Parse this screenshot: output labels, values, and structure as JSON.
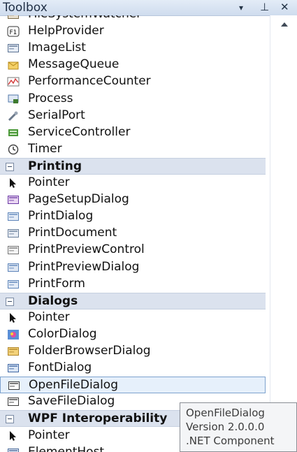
{
  "toolbox": {
    "title": "Toolbox",
    "dropdown_glyph": "▾",
    "pin_glyph": "⊥",
    "close_glyph": "✕"
  },
  "items": [
    {
      "label": "FileSystemWatcher",
      "icon": "filesystemwatcher-icon",
      "type": "item"
    },
    {
      "label": "HelpProvider",
      "icon": "f1-help-icon",
      "type": "item"
    },
    {
      "label": "ImageList",
      "icon": "imagelist-icon",
      "type": "item"
    },
    {
      "label": "MessageQueue",
      "icon": "messagequeue-icon",
      "type": "item"
    },
    {
      "label": "PerformanceCounter",
      "icon": "performancecounter-icon",
      "type": "item"
    },
    {
      "label": "Process",
      "icon": "process-icon",
      "type": "item"
    },
    {
      "label": "SerialPort",
      "icon": "serialport-icon",
      "type": "item"
    },
    {
      "label": "ServiceController",
      "icon": "servicecontroller-icon",
      "type": "item"
    },
    {
      "label": "Timer",
      "icon": "timer-icon",
      "type": "item"
    },
    {
      "label": "Printing",
      "type": "category"
    },
    {
      "label": "Pointer",
      "icon": "pointer-icon",
      "type": "item"
    },
    {
      "label": "PageSetupDialog",
      "icon": "pagesetupdialog-icon",
      "type": "item"
    },
    {
      "label": "PrintDialog",
      "icon": "printdialog-icon",
      "type": "item"
    },
    {
      "label": "PrintDocument",
      "icon": "printdocument-icon",
      "type": "item"
    },
    {
      "label": "PrintPreviewControl",
      "icon": "printpreviewcontrol-icon",
      "type": "item"
    },
    {
      "label": "PrintPreviewDialog",
      "icon": "printpreviewdialog-icon",
      "type": "item"
    },
    {
      "label": "PrintForm",
      "icon": "printform-icon",
      "type": "item"
    },
    {
      "label": "Dialogs",
      "type": "category"
    },
    {
      "label": "Pointer",
      "icon": "pointer-icon",
      "type": "item"
    },
    {
      "label": "ColorDialog",
      "icon": "colordialog-icon",
      "type": "item"
    },
    {
      "label": "FolderBrowserDialog",
      "icon": "folderbrowserdialog-icon",
      "type": "item"
    },
    {
      "label": "FontDialog",
      "icon": "fontdialog-icon",
      "type": "item"
    },
    {
      "label": "OpenFileDialog",
      "icon": "openfiledialog-icon",
      "type": "item",
      "selected": true
    },
    {
      "label": "SaveFileDialog",
      "icon": "savefiledialog-icon",
      "type": "item"
    },
    {
      "label": "WPF Interoperability",
      "type": "category"
    },
    {
      "label": "Pointer",
      "icon": "pointer-icon",
      "type": "item"
    },
    {
      "label": "ElementHost",
      "icon": "elementhost-icon",
      "type": "item"
    }
  ],
  "tooltip": {
    "line1": "OpenFileDialog",
    "line2": "Version 2.0.0.0",
    "line3": ".NET Component"
  },
  "colors": {
    "selection_bg": "#e6f0fb",
    "selection_border": "#7da2ce",
    "category_bg": "#dbe2ee"
  }
}
